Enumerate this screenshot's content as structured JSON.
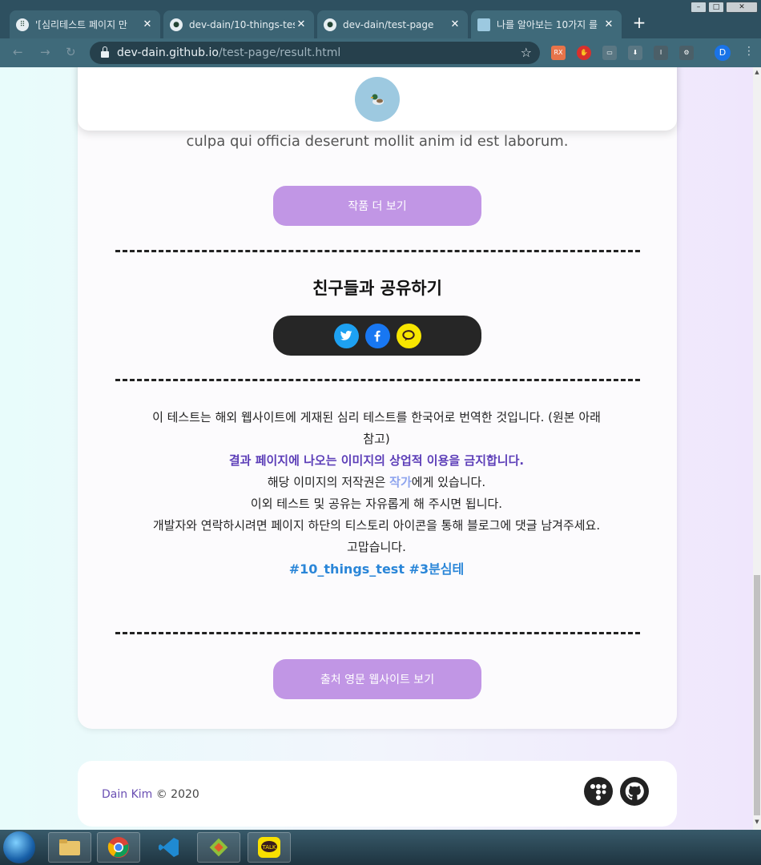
{
  "browser": {
    "tabs": [
      {
        "title": "'[심리테스트 페이지 만",
        "active": false
      },
      {
        "title": "dev-dain/10-things-tes",
        "active": false
      },
      {
        "title": "dev-dain/test-page",
        "active": false
      },
      {
        "title": "나를 알아보는 10가지 를",
        "active": true
      }
    ],
    "url_host": "dev-dain.github.io",
    "url_path": "/test-page/result.html",
    "profile_initial": "D"
  },
  "page": {
    "lorem_tail": "culpa qui officia deserunt mollit anim id est laborum.",
    "more_works_button": "작품 더 보기",
    "share_title": "친구들과 공유하기",
    "notice": {
      "line1": "이 테스트는 해외 웹사이트에 게재된 심리 테스트를 한국어로 번역한 것입니다. (원본 아래 참고)",
      "warning": "결과 페이지에 나오는 이미지의 상업적 이용을 금지합니다.",
      "copyright_prefix": "해당 이미지의 저작권은 ",
      "copyright_link": "작가",
      "copyright_suffix": "에게 있습니다.",
      "line4": "이외 테스트 및 공유는 자유롭게 해 주시면 됩니다.",
      "line5": "개발자와 연락하시려면 페이지 하단의 티스토리 아이콘을 통해 블로그에 댓글 남겨주세요.",
      "line6": "고맙습니다.",
      "tags": "#10_things_test #3분심테"
    },
    "source_button": "출처 영문 웹사이트 보기"
  },
  "footer": {
    "name": "Dain Kim",
    "copyright": " © 2020"
  },
  "colors": {
    "button": "#c196e5",
    "warning": "#5c3eb8",
    "tags": "#2a86d8",
    "twitter": "#1da1f2",
    "facebook": "#1877f2",
    "kakao": "#f7e600"
  }
}
